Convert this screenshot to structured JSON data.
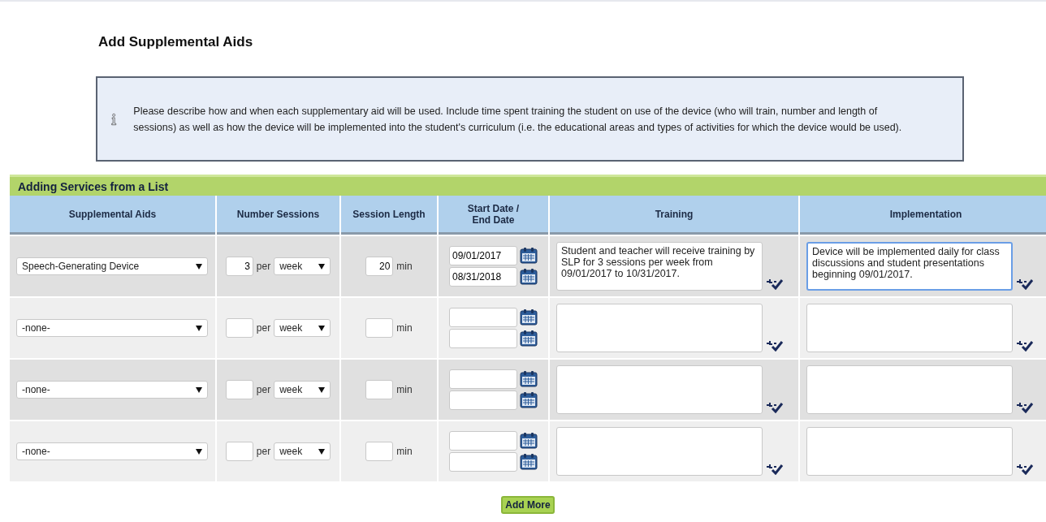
{
  "page_title": "Add Supplemental Aids",
  "info": {
    "text": "Please describe how and when each supplementary aid will be used. Include time spent training the student on use of the device (who will train, number and length of sessions) as well as how the device will be implemented into the student's curriculum (i.e. the educational areas and types of activities for which the device would be used)."
  },
  "table": {
    "title": "Adding Services from a List",
    "columns": [
      "Supplemental Aids",
      "Number Sessions",
      "Session Length",
      "Start Date / End Date",
      "Training",
      "Implementation"
    ],
    "rows": [
      {
        "aid": "Speech-Generating Device",
        "sessions": "3",
        "per": "per",
        "period": "week",
        "length": "20",
        "unit": "min",
        "start": "09/01/2017",
        "end": "08/31/2018",
        "training": "Student and teacher will receive training by SLP for 3 sessions per week from 09/01/2017 to 10/31/2017.",
        "implementation": "Device will be implemented daily for class discussions and student presentations beginning 09/01/2017.",
        "implementation_focused": true
      },
      {
        "aid": "-none-",
        "per": "per",
        "period": "week",
        "unit": "min",
        "implementation_focused": false
      },
      {
        "aid": "-none-",
        "per": "per",
        "period": "week",
        "unit": "min",
        "implementation_focused": false
      },
      {
        "aid": "-none-",
        "per": "per",
        "period": "week",
        "unit": "min",
        "implementation_focused": false
      }
    ]
  },
  "add_button": "Add More"
}
